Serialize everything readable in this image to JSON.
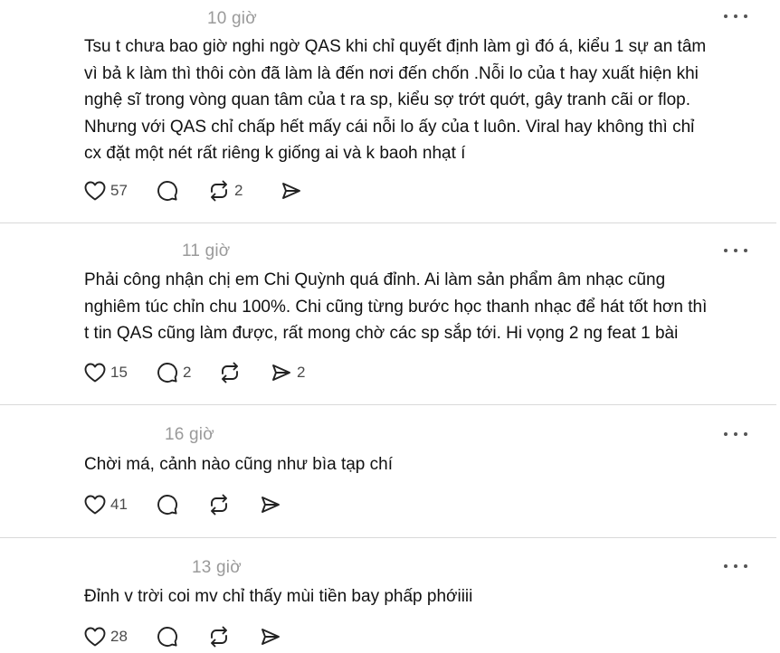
{
  "posts": [
    {
      "time": "10 giờ",
      "lines": [
        "Tsu t chưa bao giờ nghi ngờ QAS khi chỉ quyết định làm gì đó á, kiểu 1 sự an tâm",
        "vì bả k làm thì thôi còn đã làm là đến nơi đến chốn .Nỗi lo của t hay xuất hiện khi",
        "nghệ sĩ trong vòng quan tâm của t ra sp, kiểu sợ trớt quớt, gây tranh cãi or flop.",
        "Nhưng với QAS chỉ chấp hết mấy cái nỗi lo ấy của t luôn. Viral hay không thì chỉ",
        "cx đặt một nét rất riêng k giống ai và k baoh nhạt í"
      ],
      "likes": "57",
      "replies": "",
      "reposts": "2",
      "shares": ""
    },
    {
      "time": "11 giờ",
      "lines": [
        "Phải công nhận chị em Chi Quỳnh quá đỉnh. Ai làm sản phẩm âm nhạc cũng",
        "nghiêm túc chỉn chu 100%. Chi cũng từng bước học thanh nhạc để hát tốt hơn thì",
        "t tin QAS cũng làm được, rất mong chờ các sp sắp tới. Hi vọng 2 ng feat 1 bài"
      ],
      "likes": "15",
      "replies": "2",
      "reposts": "",
      "shares": "2"
    },
    {
      "time": "16 giờ",
      "lines": [
        "Chời má, cảnh nào cũng như bìa tạp chí"
      ],
      "likes": "41",
      "replies": "",
      "reposts": "",
      "shares": ""
    },
    {
      "time": "13 giờ",
      "lines": [
        "Đỉnh v trời coi mv chỉ thấy mùi tiền bay phấp phớiiii"
      ],
      "likes": "28",
      "replies": "",
      "reposts": "",
      "shares": ""
    }
  ]
}
